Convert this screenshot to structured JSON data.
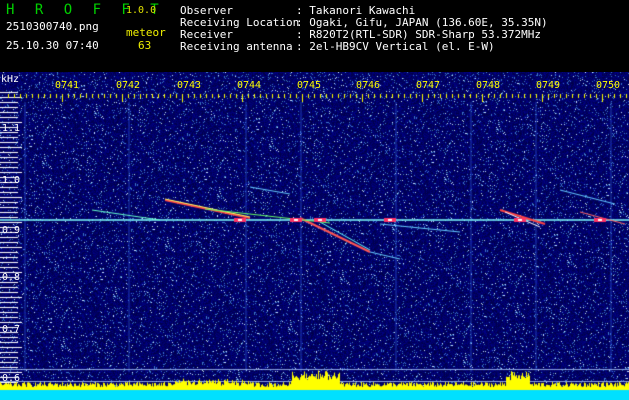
{
  "app": {
    "name": "H R O F F T",
    "version": "1.0.0"
  },
  "file": {
    "name": "2510300740.png",
    "datetime": "25.10.30 07:40"
  },
  "meteor": {
    "label": "meteor",
    "count": "63"
  },
  "info": [
    {
      "label": "Observer",
      "value": ": Takanori Kawachi"
    },
    {
      "label": "Receiving Location",
      "value": ": Ogaki, Gifu, JAPAN (136.60E, 35.35N)"
    },
    {
      "label": "Receiver",
      "value": ": R820T2(RTL-SDR) SDR-Sharp 53.372MHz"
    },
    {
      "label": "Receiving antenna",
      "value": ": 2el-HB9CV Vertical (el. E-W)"
    }
  ],
  "axis": {
    "unit": "kHz",
    "time_ticks": [
      "0741",
      "0742",
      "0743",
      "0744",
      "0745",
      "0746",
      "0747",
      "0748",
      "0749",
      "0750"
    ],
    "freq_ticks": [
      "1.1",
      "1.0",
      "0.9",
      "0.8",
      "0.7",
      "0.6"
    ]
  },
  "colors": {
    "background": "#000066",
    "carrier": "#7fffff",
    "echo": "#ff3333",
    "level": "#ffff00"
  }
}
